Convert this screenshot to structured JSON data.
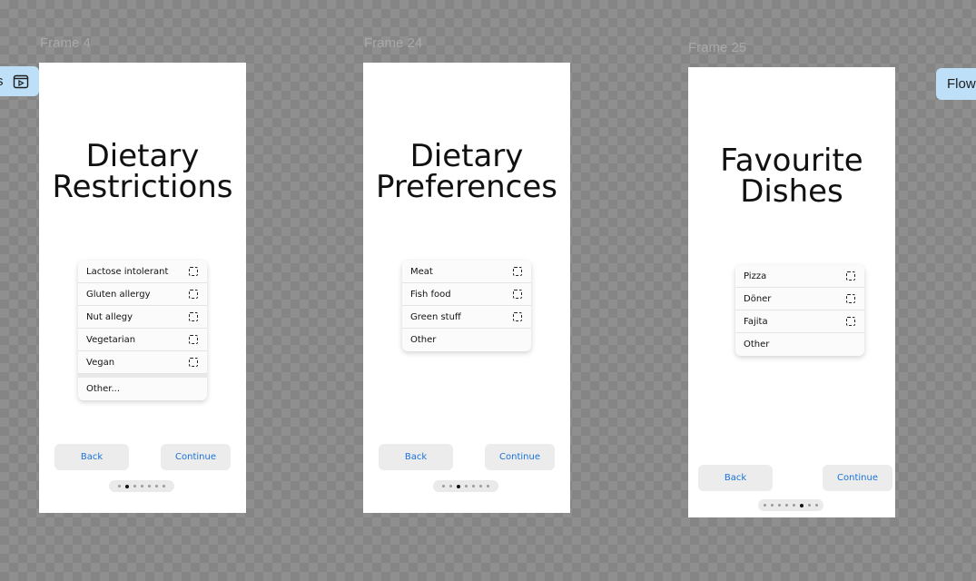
{
  "canvas": {
    "left_tab_text": "s",
    "flow_label": "Flow"
  },
  "frames": [
    {
      "label": "Frame 4",
      "title_lines": [
        "Dietary",
        "Restrictions"
      ],
      "items": [
        "Lactose intolerant",
        "Gluten allergy",
        "Nut allegy",
        "Vegetarian",
        "Vegan"
      ],
      "other": "Other...",
      "back": "Back",
      "continue": "Continue",
      "page_dots": 7,
      "active_page": 2
    },
    {
      "label": "Frame 24",
      "title_lines": [
        "Dietary",
        "Preferences"
      ],
      "items": [
        "Meat",
        "Fish food",
        "Green stuff"
      ],
      "other": "Other",
      "back": "Back",
      "continue": "Continue",
      "page_dots": 7,
      "active_page": 3
    },
    {
      "label": "Frame 25",
      "title_lines": [
        "Favourite",
        "Dishes"
      ],
      "items": [
        "Pizza",
        "Döner",
        "Fajita"
      ],
      "other": "Other",
      "back": "Back",
      "continue": "Continue",
      "page_dots": 8,
      "active_page": 6
    }
  ]
}
